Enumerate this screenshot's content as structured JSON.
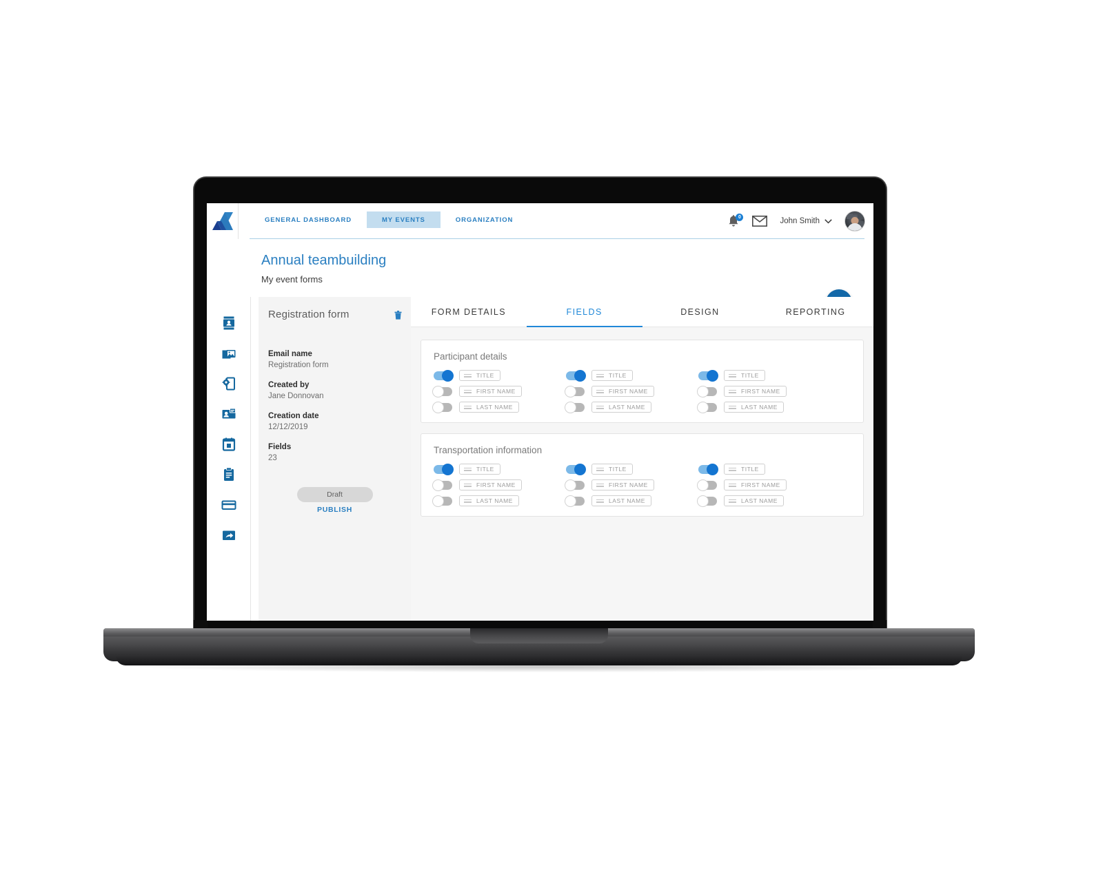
{
  "header": {
    "logo_name": "app-logo",
    "nav_tabs": [
      {
        "label": "GENERAL DASHBOARD",
        "active": false
      },
      {
        "label": "MY EVENTS",
        "active": true
      },
      {
        "label": "ORGANIZATION",
        "active": false
      }
    ],
    "notification_count": "0",
    "user_name": "John Smith",
    "chevron": "⌄"
  },
  "page": {
    "title": "Annual teambuilding",
    "subtitle": "My event forms",
    "add_button_label": "+"
  },
  "sidebar": {
    "items": [
      {
        "name": "contacts-icon"
      },
      {
        "name": "media-gallery-icon"
      },
      {
        "name": "settings-page-icon"
      },
      {
        "name": "badge-icon"
      },
      {
        "name": "calendar-icon"
      },
      {
        "name": "clipboard-icon"
      },
      {
        "name": "payment-card-icon"
      },
      {
        "name": "share-export-icon"
      }
    ]
  },
  "form_panel": {
    "title": "Registration form",
    "delete_icon": "trash-icon",
    "details": [
      {
        "label": "Email name",
        "value": "Registration form"
      },
      {
        "label": "Created by",
        "value": "Jane Donnovan"
      },
      {
        "label": "Creation date",
        "value": "12/12/2019"
      },
      {
        "label": "Fields",
        "value": "23"
      }
    ],
    "status_pill": "Draft",
    "publish_label": "PUBLISH"
  },
  "tabs": [
    {
      "label": "FORM DETAILS",
      "active": false
    },
    {
      "label": "FIELDS",
      "active": true
    },
    {
      "label": "DESIGN",
      "active": false
    },
    {
      "label": "REPORTING",
      "active": false
    }
  ],
  "cards": [
    {
      "title": "Participant details",
      "rows": [
        {
          "label": "TITLE",
          "toggles": [
            true,
            true,
            true
          ]
        },
        {
          "label": "FIRST NAME",
          "toggles": [
            false,
            false,
            false
          ]
        },
        {
          "label": "LAST NAME",
          "toggles": [
            false,
            false,
            false
          ]
        }
      ]
    },
    {
      "title": "Transportation information",
      "rows": [
        {
          "label": "TITLE",
          "toggles": [
            true,
            true,
            true
          ]
        },
        {
          "label": "FIRST NAME",
          "toggles": [
            false,
            false,
            false
          ]
        },
        {
          "label": "LAST NAME",
          "toggles": [
            false,
            false,
            false
          ]
        }
      ]
    }
  ],
  "colors": {
    "accent_blue": "#2a7fc1",
    "tab_active_blue": "#2088d8",
    "nav_active_bg": "#c3ddef",
    "toggle_on_track": "#7cb9e8",
    "toggle_on_knob": "#1475d1",
    "fab_blue": "#1368a8",
    "panel_grey": "#f4f4f4",
    "pane_bg": "#f6f6f6"
  }
}
